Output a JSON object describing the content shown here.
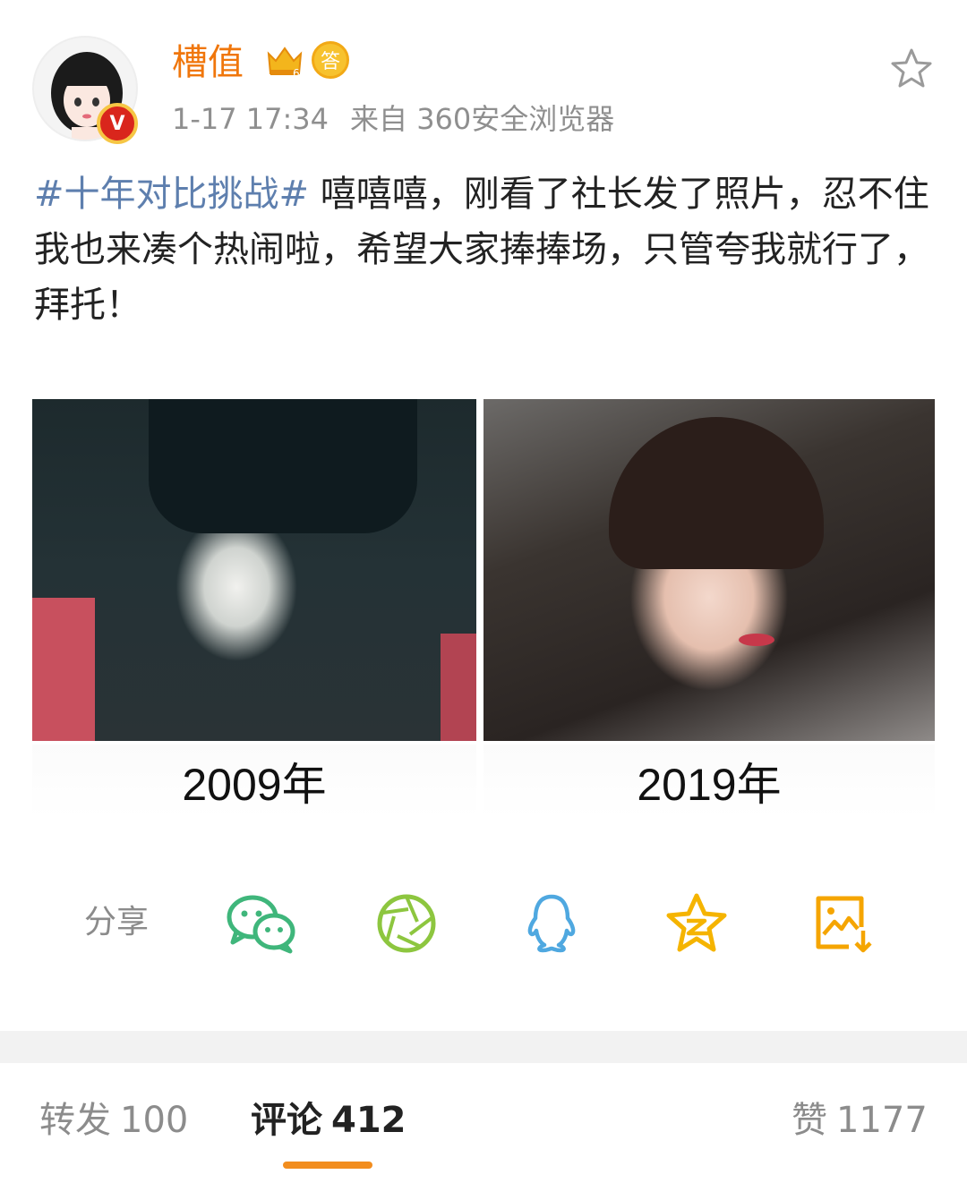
{
  "header": {
    "username": "槽值",
    "crown_level": "6",
    "answer_badge": "答",
    "verified_mark": "V",
    "time": "1-17 17:34",
    "source": "来自 360安全浏览器"
  },
  "post": {
    "hashtag": "#十年对比挑战#",
    "text": "嘻嘻嘻，刚看了社长发了照片，忍不住我也来凑个热闹啦，希望大家捧捧场，只管夸我就行了，拜托！"
  },
  "images": [
    {
      "caption": "2009年"
    },
    {
      "caption": "2019年"
    }
  ],
  "share": {
    "label": "分享",
    "targets": [
      "wechat-icon",
      "moments-icon",
      "qq-icon",
      "qzone-icon",
      "save-image-icon"
    ],
    "colors": {
      "wechat": "#3fb67b",
      "moments": "#8dc63f",
      "qq": "#4fa8e0",
      "qzone": "#f5b400",
      "save": "#f5a500"
    }
  },
  "tabs": {
    "repost": {
      "label": "转发",
      "count": "100"
    },
    "comment": {
      "label": "评论",
      "count": "412"
    },
    "like": {
      "label": "赞",
      "count": "1177"
    }
  },
  "colors": {
    "accent": "#f28d1e",
    "username": "#f0760b",
    "hashtag": "#5e7fae"
  }
}
